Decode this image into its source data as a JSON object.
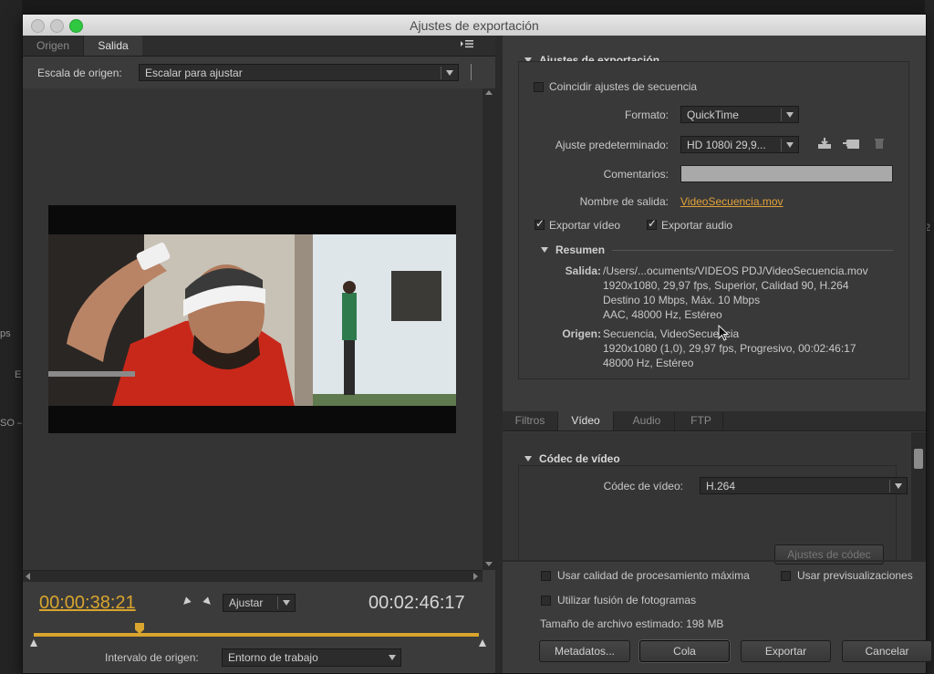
{
  "window": {
    "title": "Ajustes de exportación"
  },
  "left_tabs": [
    "Origen",
    "Salida"
  ],
  "panel_menu_icon": "panel-menu-icon",
  "scale": {
    "label": "Escala de origen:",
    "value": "Escalar para ajustar"
  },
  "playback": {
    "current_timecode": "00:00:38:21",
    "duration_timecode": "00:02:46:17",
    "fit_value": "Ajustar",
    "range_label": "Intervalo de origen:",
    "range_value": "Entorno de trabajo"
  },
  "export_settings": {
    "header": "Ajustes de exportación",
    "match_sequence": "Coincidir ajustes de secuencia",
    "format_label": "Formato:",
    "format_value": "QuickTime",
    "preset_label": "Ajuste predeterminado:",
    "preset_value": "HD 1080i 29,9...",
    "comments_label": "Comentarios:",
    "comments_value": "",
    "output_name_label": "Nombre de salida:",
    "output_name_value": "VideoSecuencia.mov",
    "export_video": "Exportar vídeo",
    "export_audio": "Exportar audio",
    "summary_header": "Resumen",
    "output_label": "Salida:",
    "output_lines": [
      "/Users/...ocuments/VIDEOS PDJ/VideoSecuencia.mov",
      "1920x1080, 29,97 fps, Superior, Calidad 90, H.264",
      "Destino 10 Mbps, Máx. 10 Mbps",
      "AAC, 48000 Hz, Estéreo"
    ],
    "source_label": "Origen:",
    "source_lines": [
      "Secuencia, VideoSecuencia",
      "1920x1080 (1,0), 29,97 fps, Progresivo, 00:02:46:17",
      "48000 Hz, Estéreo"
    ]
  },
  "sub_tabs": [
    "Filtros",
    "Vídeo",
    "Audio",
    "FTP"
  ],
  "codec": {
    "header": "Códec de vídeo",
    "label": "Códec de vídeo:",
    "value": "H.264",
    "settings_button": "Ajustes de códec"
  },
  "options": {
    "max_quality": "Usar calidad de procesamiento máxima",
    "use_previews": "Usar previsualizaciones",
    "frame_blending": "Utilizar fusión de fotogramas",
    "file_size": "Tamaño de archivo estimado:  198 MB"
  },
  "buttons": {
    "metadata": "Metadatos...",
    "queue": "Cola",
    "export": "Exportar",
    "cancel": "Cancelar"
  },
  "bg_app": {
    "left_labels": [
      "ps",
      "E",
      "SO –"
    ],
    "right_label": "2"
  },
  "colors": {
    "accent": "#d9a52e",
    "panel": "#3b3b3b",
    "link": "#e2a23a"
  }
}
